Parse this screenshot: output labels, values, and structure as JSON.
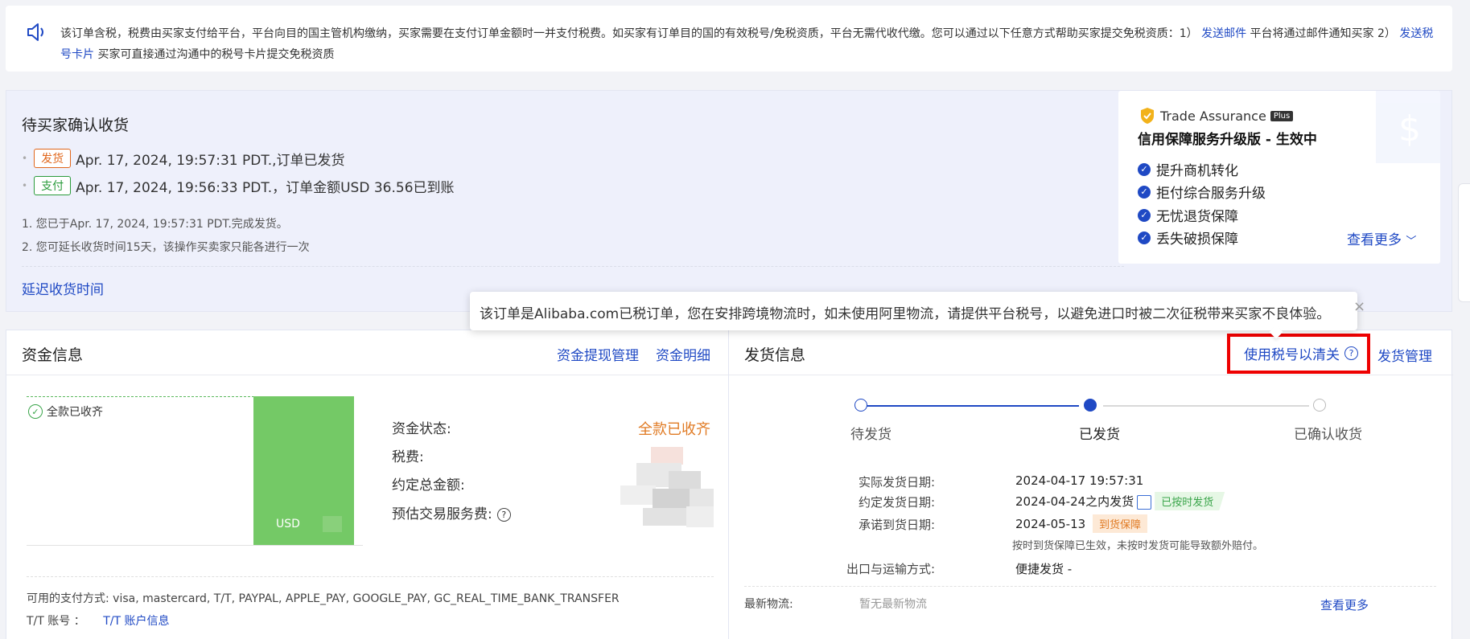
{
  "notice": {
    "speaker_icon": "speaker-icon",
    "text_1": "该订单含税，税费由买家支付给平台，平台向目的国主管机构缴纳，买家需要在支付订单金额时一并支付税费。如买家有订单目的国的有效税号/免税资质，平台无需代收代缴。您可以通过以下任意方式帮助买家提交免税资质：1）",
    "link_email": "发送邮件",
    "text_2": "平台将通过邮件通知买家 2）",
    "link_card": "发送税号卡片",
    "text_3": "买家可直接通过沟通中的税号卡片提交免税资质"
  },
  "status": {
    "title": "待买家确认收货",
    "events": [
      {
        "tag": "发货",
        "text": "Apr. 17, 2024, 19:57:31 PDT.,订单已发货"
      },
      {
        "tag": "支付",
        "text": "Apr. 17, 2024, 19:56:33 PDT.，订单金额USD 36.56已到账"
      }
    ],
    "notes": [
      "1. 您已于Apr. 17, 2024, 19:57:31 PDT.完成发货。",
      "2. 您可延长收货时间15天，该操作买卖家只能各进行一次"
    ],
    "delay_link": "延迟收货时间"
  },
  "trade_assurance": {
    "brand": "Trade Assurance",
    "plus": "Plus",
    "subtitle": "信用保障服务升级版 - 生效中",
    "features": [
      "提升商机转化",
      "拒付综合服务升级",
      "无忧退货保障",
      "丢失破损保障"
    ],
    "more": "查看更多",
    "accent": "#1f49c4"
  },
  "tooltip": {
    "text": "该订单是Alibaba.com已税订单，您在安排跨境物流时，如未使用阿里物流，请提供平台税号，以避免进口时被二次征税带来买家不良体验。",
    "close": "×"
  },
  "fund": {
    "title": "资金信息",
    "links": [
      "资金提现管理",
      "资金明细"
    ],
    "bar_flag": "全款已收齐",
    "bar_label": "USD",
    "bar_fraction": 1.0,
    "fields": {
      "status_label": "资金状态:",
      "status_value": "全款已收齐",
      "tax_label": "税费:",
      "total_label": "约定总金额:",
      "fee_label": "预估交易服务费:"
    },
    "payment_methods": "可用的支付方式: visa, mastercard, T/T, PAYPAL, APPLE_PAY, GOOGLE_PAY, GC_REAL_TIME_BANK_TRANSFER",
    "tt_label": "T/T 账号 ：",
    "tt_link": "T/T 账户信息"
  },
  "ship": {
    "title": "发货信息",
    "tax_link": "使用税号以清关",
    "mgr_link": "发货管理",
    "steps": [
      "待发货",
      "已发货",
      "已确认收货"
    ],
    "current_step": 1,
    "details": {
      "actual_label": "实际发货日期:",
      "actual_value": "2024-04-17 19:57:31",
      "agreed_label": "约定发货日期:",
      "agreed_value": "2024-04-24之内发货",
      "agreed_chip": "已按时发货",
      "promise_label": "承诺到货日期:",
      "promise_value": "2024-05-13",
      "promise_chip": "到货保障",
      "promise_note": "按时到货保障已生效，未按时发货可能导致额外赔付。",
      "export_label": "出口与运输方式:",
      "export_value": "便捷发货 -"
    },
    "latest_label": "最新物流:",
    "latest_value": "暂无最新物流",
    "more": "查看更多"
  }
}
